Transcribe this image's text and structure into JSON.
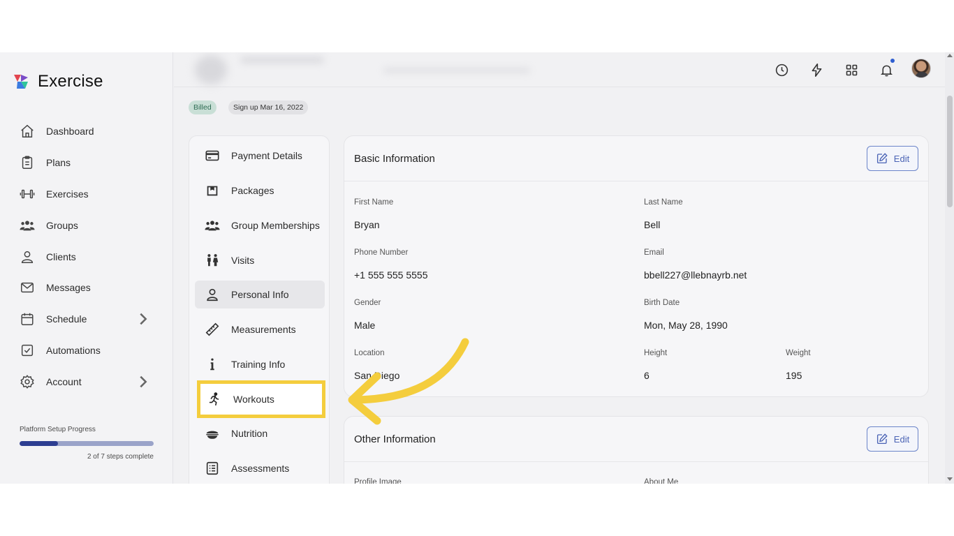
{
  "brand": {
    "name": "Exercise",
    "colors": [
      "#e2454f",
      "#3a7be0",
      "#7a4cc7",
      "#2fc49a"
    ]
  },
  "sidebar": {
    "items": [
      {
        "label": "Dashboard",
        "icon": "home-icon"
      },
      {
        "label": "Plans",
        "icon": "clipboard-icon"
      },
      {
        "label": "Exercises",
        "icon": "dumbbell-icon"
      },
      {
        "label": "Groups",
        "icon": "users-icon"
      },
      {
        "label": "Clients",
        "icon": "user-icon"
      },
      {
        "label": "Messages",
        "icon": "mail-icon"
      },
      {
        "label": "Schedule",
        "icon": "calendar-icon",
        "has_submenu": true
      },
      {
        "label": "Automations",
        "icon": "checkbox-icon"
      },
      {
        "label": "Account",
        "icon": "gear-icon",
        "has_submenu": true
      }
    ],
    "progress": {
      "label": "Platform Setup Progress",
      "steps_text": "2 of 7 steps complete",
      "completed": 2,
      "total": 7
    }
  },
  "header": {
    "icons": [
      "clock-icon",
      "lightning-icon",
      "grid-icon",
      "bell-icon"
    ],
    "has_notification": true
  },
  "badges": {
    "billed": "Billed",
    "signup": "Sign up Mar 16, 2022"
  },
  "client_menu": {
    "items": [
      {
        "label": "Payment Details",
        "icon": "credit-card-icon"
      },
      {
        "label": "Packages",
        "icon": "package-icon"
      },
      {
        "label": "Group Memberships",
        "icon": "group-icon"
      },
      {
        "label": "Visits",
        "icon": "visits-icon"
      },
      {
        "label": "Personal Info",
        "icon": "person-icon",
        "active": true
      },
      {
        "label": "Measurements",
        "icon": "ruler-icon"
      },
      {
        "label": "Training Info",
        "icon": "info-icon"
      },
      {
        "label": "Workouts",
        "icon": "running-icon",
        "highlighted": true
      },
      {
        "label": "Nutrition",
        "icon": "bowl-icon"
      },
      {
        "label": "Assessments",
        "icon": "checklist-icon"
      }
    ]
  },
  "basic_info": {
    "title": "Basic Information",
    "edit_label": "Edit",
    "first_name_label": "First Name",
    "first_name": "Bryan",
    "last_name_label": "Last Name",
    "last_name": "Bell",
    "phone_label": "Phone Number",
    "phone": "+1 555 555 5555",
    "email_label": "Email",
    "email": "bbell227@llebnayrb.net",
    "gender_label": "Gender",
    "gender": "Male",
    "birth_label": "Birth Date",
    "birth": "Mon, May 28, 1990",
    "location_label": "Location",
    "location": "San Diego",
    "height_label": "Height",
    "height": "6",
    "weight_label": "Weight",
    "weight": "195"
  },
  "other_info": {
    "title": "Other Information",
    "edit_label": "Edit",
    "profile_image_label": "Profile Image",
    "about_label": "About Me"
  },
  "annotation": {
    "color": "#f4cd3d",
    "icon": "curved-arrow-icon"
  }
}
